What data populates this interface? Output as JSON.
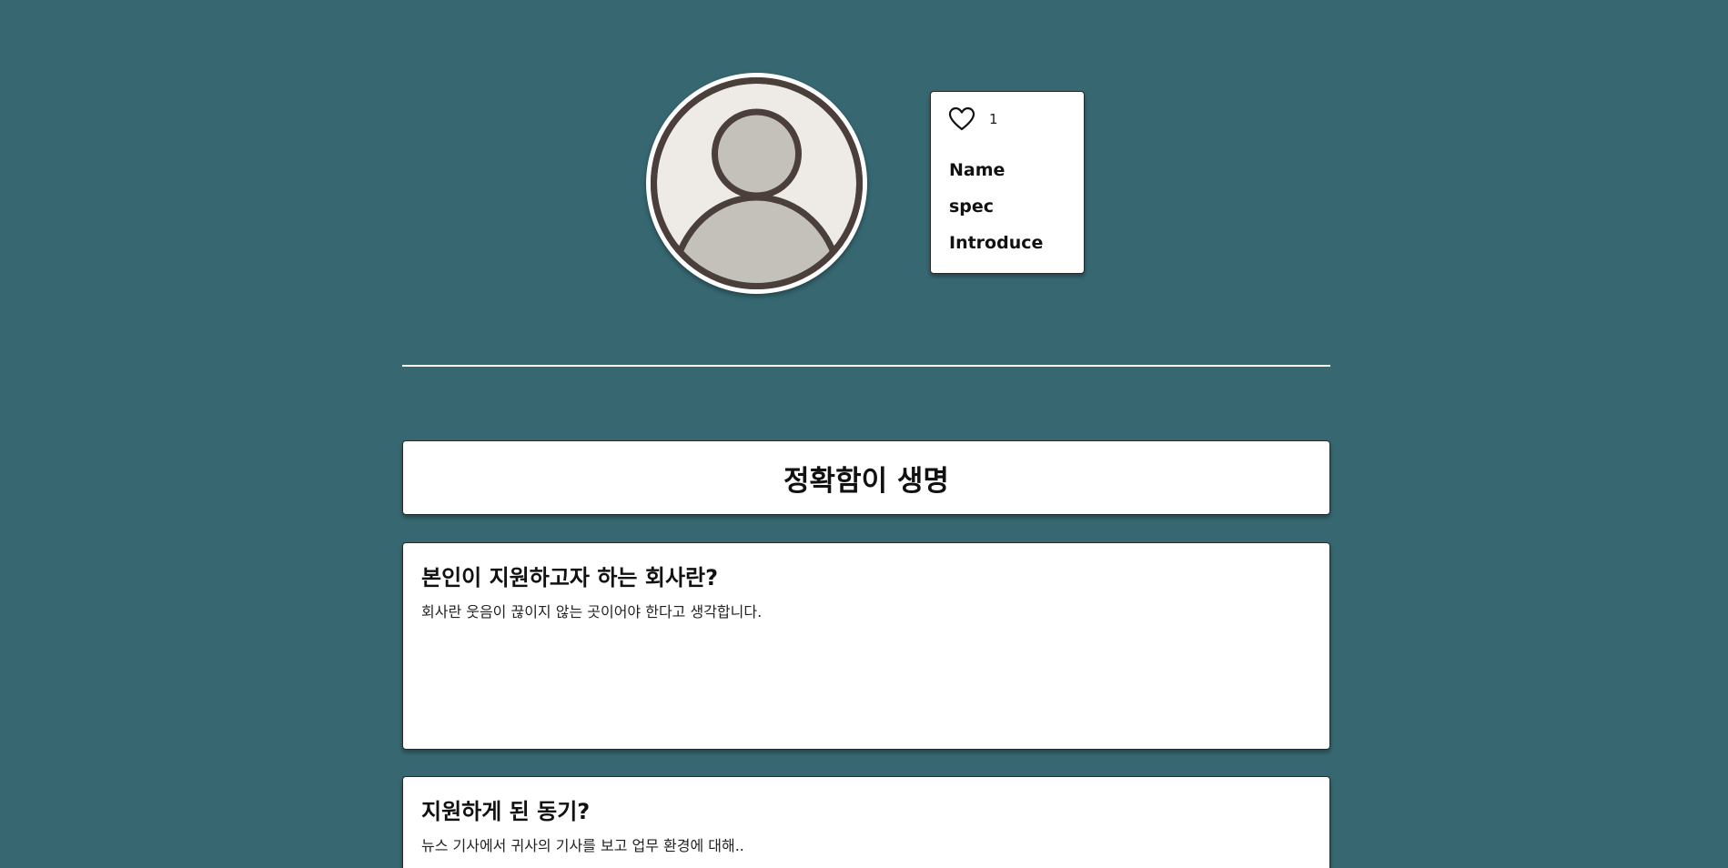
{
  "profile": {
    "avatar_icon": "user-avatar-icon",
    "like": {
      "icon": "heart-icon",
      "count": "1"
    },
    "labels": {
      "name": "Name",
      "spec": "spec",
      "introduce": "Introduce"
    }
  },
  "motto": {
    "title": "정확함이 생명"
  },
  "qa": [
    {
      "question": "본인이 지원하고자 하는 회사란?",
      "answer": "회사란 웃음이 끊이지 않는 곳이어야 한다고 생각합니다."
    },
    {
      "question": "지원하게 된 동기?",
      "answer": "뉴스 기사에서 귀사의 기사를 보고 업무 환경에 대해.."
    }
  ],
  "colors": {
    "background": "#376872",
    "card": "#ffffff",
    "avatar_bg": "#eeebe7",
    "avatar_fill": "#c4c1bb",
    "avatar_stroke": "#4a3f3a"
  }
}
